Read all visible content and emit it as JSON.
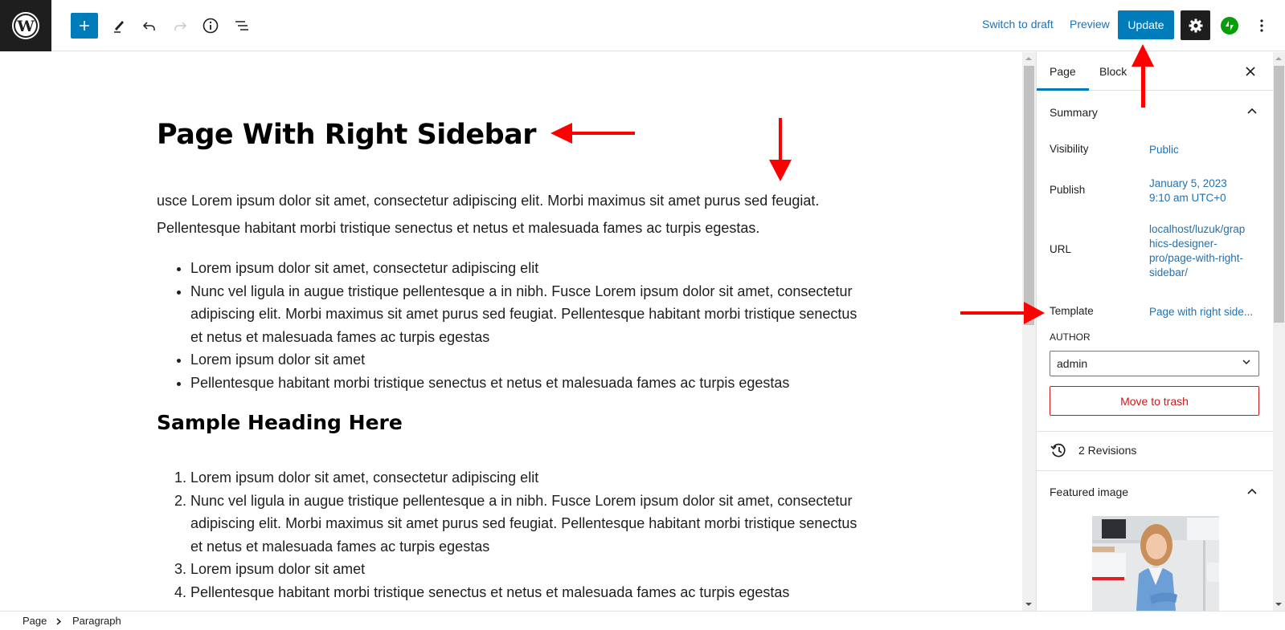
{
  "header": {
    "logo_icon": "wordpress-logo",
    "toolbar_icons": [
      "plus-icon",
      "pencil-tools-icon",
      "undo-icon",
      "redo-icon",
      "info-icon",
      "list-view-icon"
    ],
    "switch_to_draft": "Switch to draft",
    "preview": "Preview",
    "update": "Update",
    "settings_icon": "gear-icon",
    "jetpack_icon": "jetpack-bolt-icon",
    "options_icon": "kebab-icon"
  },
  "editor": {
    "title": "Page With Right Sidebar",
    "paragraph": "usce Lorem ipsum dolor sit amet, consectetur adipiscing elit. Morbi maximus sit amet purus sed feugiat. Pellentesque habitant morbi tristique senectus et netus et malesuada fames ac turpis egestas.",
    "bullet_list": [
      "Lorem ipsum dolor sit amet, consectetur adipiscing elit",
      "Nunc vel ligula in augue tristique pellentesque a in nibh. Fusce Lorem ipsum dolor sit amet, consectetur adipiscing elit. Morbi maximus sit amet purus sed feugiat. Pellentesque habitant morbi tristique senectus et netus et malesuada fames ac turpis egestas",
      "Lorem ipsum dolor sit amet",
      "Pellentesque habitant morbi tristique senectus et netus et malesuada fames ac turpis egestas"
    ],
    "heading": "Sample Heading Here",
    "numbered_list": [
      "Lorem ipsum dolor sit amet, consectetur adipiscing elit",
      "Nunc vel ligula in augue tristique pellentesque a in nibh. Fusce Lorem ipsum dolor sit amet, consectetur adipiscing elit. Morbi maximus sit amet purus sed feugiat. Pellentesque habitant morbi tristique senectus et netus et malesuada fames ac turpis egestas",
      "Lorem ipsum dolor sit amet",
      "Pellentesque habitant morbi tristique senectus et netus et malesuada fames ac turpis egestas"
    ]
  },
  "sidebar": {
    "tabs": [
      {
        "label": "Page",
        "active": true
      },
      {
        "label": "Block",
        "active": false
      }
    ],
    "close_icon": "close-icon",
    "summary": {
      "title": "Summary",
      "visibility_label": "Visibility",
      "visibility_value": "Public",
      "publish_label": "Publish",
      "publish_value_line1": "January 5, 2023",
      "publish_value_line2": "9:10 am UTC+0",
      "url_label": "URL",
      "url_value": [
        "localhost/luzuk/grap",
        "hics-designer-",
        "pro/page-with-right-",
        "sidebar/"
      ],
      "template_label": "Template",
      "template_value": "Page with right side...",
      "author_label": "AUTHOR",
      "author_value": "admin",
      "trash_label": "Move to trash"
    },
    "revisions": "2 Revisions",
    "featured_image_title": "Featured image"
  },
  "footer": {
    "breadcrumb": [
      "Page",
      "Paragraph"
    ]
  },
  "colors": {
    "accent": "#007cba",
    "link": "#2271b1",
    "danger": "#cc1818",
    "annotation": "#ff0000",
    "dark": "#1e1e1e"
  }
}
